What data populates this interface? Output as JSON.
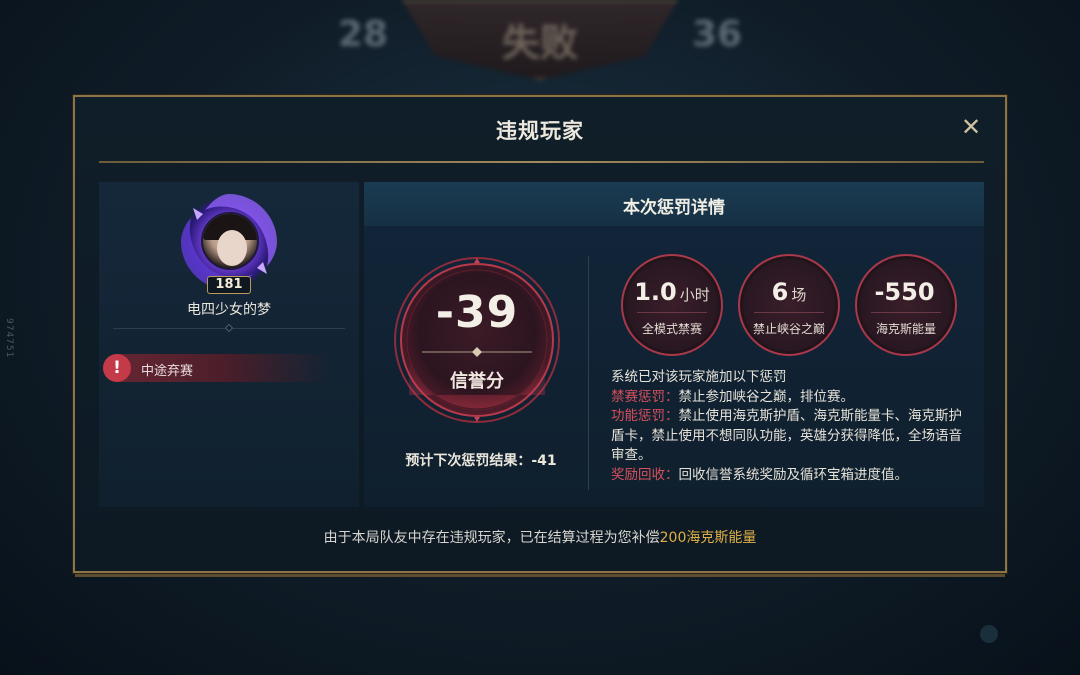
{
  "background": {
    "left_score": "28",
    "result_title": "失败",
    "right_score": "36",
    "side_text": "974751"
  },
  "dialog": {
    "title": "违规玩家",
    "close_icon": "close-icon"
  },
  "player": {
    "level": "181",
    "name": "电四少女的梦",
    "violation": "中途弃赛",
    "violation_icon": "exclamation-icon"
  },
  "penalty": {
    "title": "本次惩罚详情",
    "score_value": "-39",
    "score_label": "信誉分",
    "next_result_label": "预计下次惩罚结果：",
    "next_result_value": "-41",
    "stats": [
      {
        "value": "1.0",
        "unit": "小时",
        "label": "全模式禁赛"
      },
      {
        "value": "6",
        "unit": "场",
        "label": "禁止峡谷之巅"
      },
      {
        "value": "-550",
        "unit": "",
        "label": "海克斯能量"
      }
    ],
    "description": {
      "intro": "系统已对该玩家施加以下惩罚",
      "lines": [
        {
          "tag": "禁赛惩罚：",
          "text": "禁止参加峡谷之巅，排位赛。"
        },
        {
          "tag": "功能惩罚：",
          "text": "禁止使用海克斯护盾、海克斯能量卡、海克斯护盾卡，禁止使用不想同队功能，英雄分获得降低，全场语音审查。"
        },
        {
          "tag": "奖励回收：",
          "text": "回收信誉系统奖励及循环宝箱进度值。"
        }
      ]
    }
  },
  "footer": {
    "text": "由于本局队友中存在违规玩家，已在结算过程为您补偿",
    "highlight": "200海克斯能量"
  },
  "colors": {
    "gold_border": "#8a7448",
    "penalty_red": "#d8505c",
    "ring_red": "#a8394a",
    "highlight_gold": "#e0b046"
  }
}
